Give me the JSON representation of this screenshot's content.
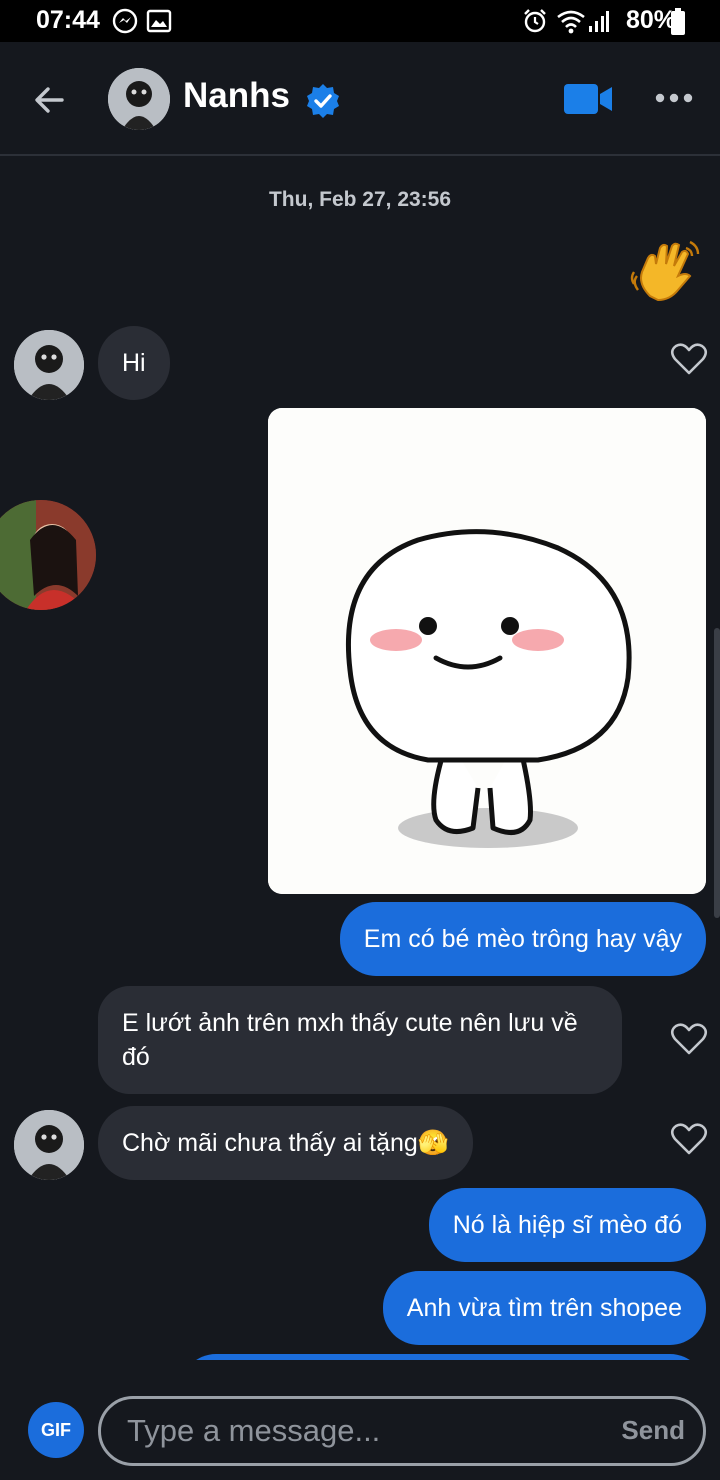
{
  "status_bar": {
    "time": "07:44",
    "battery": "80%",
    "icons": [
      "messenger-icon",
      "gallery-icon",
      "alarm-icon",
      "wifi-icon",
      "signal-icon",
      "battery-icon"
    ]
  },
  "header": {
    "contact_name": "Nanhs",
    "verified": true,
    "back_icon": "arrow-left-icon",
    "video_icon": "video-camera-icon",
    "more_icon": "more-dots-icon"
  },
  "chat": {
    "timestamp": "Thu, Feb 27, 23:56",
    "messages": [
      {
        "direction": "out",
        "type": "emoji",
        "text": "👋"
      },
      {
        "direction": "in",
        "type": "text",
        "text": "Hi"
      },
      {
        "direction": "out",
        "type": "sticker",
        "text": ""
      },
      {
        "direction": "out",
        "type": "text",
        "text": "Em có bé mèo trông hay vậy"
      },
      {
        "direction": "in",
        "type": "text",
        "text": "E lướt ảnh trên mxh thấy cute nên lưu về đó"
      },
      {
        "direction": "in",
        "type": "text",
        "text": "Chờ mãi chưa thấy ai tặng🫣"
      },
      {
        "direction": "out",
        "type": "text",
        "text": "Nó là hiệp sĩ mèo đó"
      },
      {
        "direction": "out",
        "type": "text",
        "text": "Anh vừa tìm trên shopee"
      }
    ]
  },
  "composer": {
    "gif_label": "GIF",
    "placeholder": "Type a message...",
    "send_label": "Send"
  },
  "colors": {
    "background": "#15181e",
    "incoming_bubble": "#2a2d35",
    "outgoing_bubble": "#1b6ddc",
    "accent": "#1b6ddc"
  }
}
